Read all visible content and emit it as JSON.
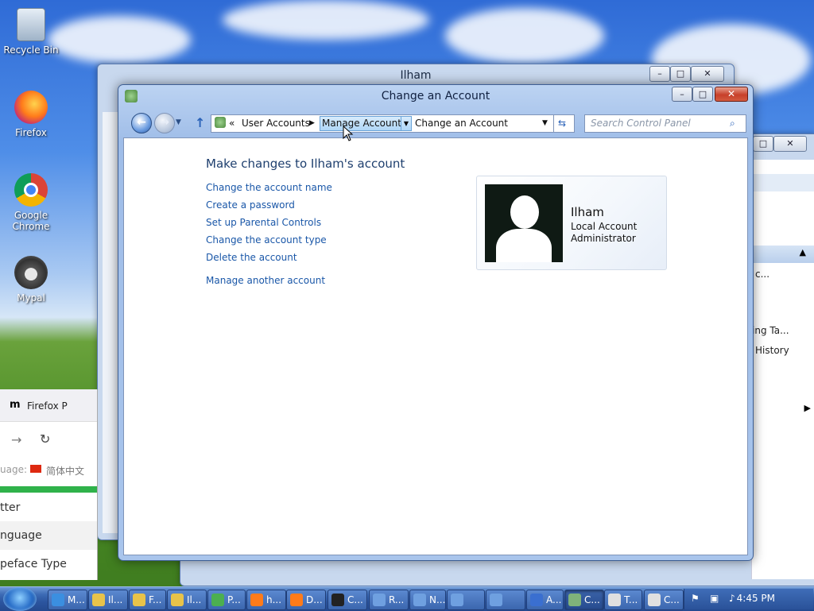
{
  "desktop": {
    "icons": [
      {
        "label": "Recycle Bin"
      },
      {
        "label": "Firefox"
      },
      {
        "label": "Google Chrome"
      },
      {
        "label": "Mypal"
      }
    ]
  },
  "bg_window": {
    "title": "Ilham"
  },
  "right_window": {
    "lines": [
      "c...",
      "ing Ta...",
      "History"
    ]
  },
  "firefox_window": {
    "tab_label": "Firefox P",
    "language_label": "uage:",
    "language_value": "简体中文",
    "menu_items": [
      "tter",
      "nguage",
      "peface Type"
    ]
  },
  "main_window": {
    "title": "Change an Account",
    "address": {
      "prefix": "«",
      "crumb1": "User Accounts",
      "crumb2": "Manage Accounts",
      "crumb3": "Change an Account"
    },
    "search_placeholder": "Search Control Panel",
    "heading": "Make changes to Ilham's account",
    "links": [
      "Change the account name",
      "Create a password",
      "Set up Parental Controls",
      "Change the account type",
      "Delete the account"
    ],
    "manage_link": "Manage another account",
    "account": {
      "name": "Ilham",
      "type": "Local Account",
      "role": "Administrator"
    }
  },
  "taskbar": {
    "buttons": [
      {
        "label": "M...",
        "icon": "ie-icon",
        "color": "#3b8fe0"
      },
      {
        "label": "Il...",
        "icon": "folder-icon",
        "color": "#e8c34a"
      },
      {
        "label": "F...",
        "icon": "folder-icon",
        "color": "#e8c34a"
      },
      {
        "label": "Il...",
        "icon": "folder-icon",
        "color": "#e8c34a"
      },
      {
        "label": "P...",
        "icon": "chrome-icon",
        "color": "#4caf50"
      },
      {
        "label": "h...",
        "icon": "firefox-icon",
        "color": "#ff7b1a"
      },
      {
        "label": "D...",
        "icon": "firefox-icon",
        "color": "#ff7b1a"
      },
      {
        "label": "C...",
        "icon": "cmd-icon",
        "color": "#222222"
      },
      {
        "label": "R...",
        "icon": "network-icon",
        "color": "#6fa0e0"
      },
      {
        "label": "N...",
        "icon": "network-icon",
        "color": "#6fa0e0"
      },
      {
        "label": "",
        "icon": "network-icon",
        "color": "#6fa0e0"
      },
      {
        "label": "",
        "icon": "network-icon",
        "color": "#6fa0e0"
      },
      {
        "label": "A...",
        "icon": "flag-icon",
        "color": "#3a6fd0"
      },
      {
        "label": "C...",
        "icon": "control-panel-icon",
        "color": "#7fb27a"
      },
      {
        "label": "T...",
        "icon": "clock-icon",
        "color": "#e0e0e0"
      },
      {
        "label": "C...",
        "icon": "clock-icon",
        "color": "#e0e0e0"
      }
    ],
    "clock": "4:45 PM"
  }
}
